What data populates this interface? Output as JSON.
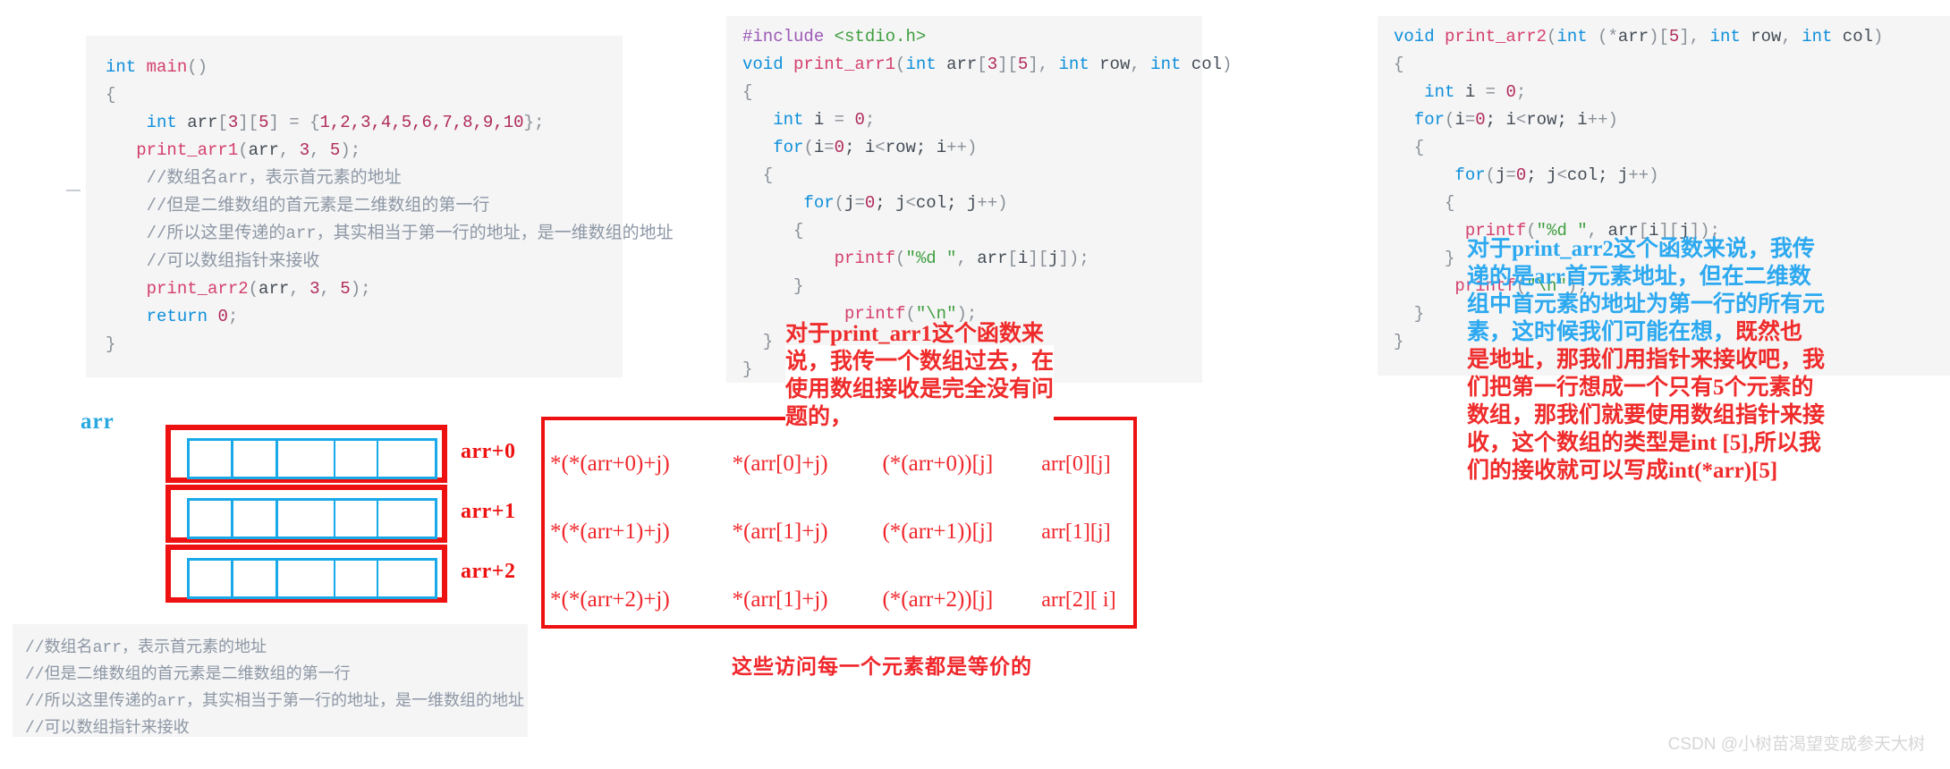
{
  "code_main": {
    "lines": [
      [
        {
          "t": "int",
          "c": "kw"
        },
        {
          "t": " ",
          "c": "ident"
        },
        {
          "t": "main",
          "c": "fn"
        },
        {
          "t": "()",
          "c": "punct"
        }
      ],
      [
        {
          "t": "{",
          "c": "punct"
        }
      ],
      [
        {
          "t": "    ",
          "c": "ident"
        },
        {
          "t": "int",
          "c": "kw"
        },
        {
          "t": " arr",
          "c": "ident"
        },
        {
          "t": "[",
          "c": "punct"
        },
        {
          "t": "3",
          "c": "num"
        },
        {
          "t": "][",
          "c": "punct"
        },
        {
          "t": "5",
          "c": "num"
        },
        {
          "t": "] ",
          "c": "punct"
        },
        {
          "t": "= ",
          "c": "punct"
        },
        {
          "t": "{",
          "c": "punct"
        },
        {
          "t": "1,2,3,4,5,6,7,8,9,10",
          "c": "num"
        },
        {
          "t": "};",
          "c": "punct"
        }
      ],
      [
        {
          "t": "   ",
          "c": "ident"
        },
        {
          "t": "print_arr1",
          "c": "fn"
        },
        {
          "t": "(",
          "c": "punct"
        },
        {
          "t": "arr",
          "c": "ident"
        },
        {
          "t": ", ",
          "c": "punct"
        },
        {
          "t": "3",
          "c": "num"
        },
        {
          "t": ", ",
          "c": "punct"
        },
        {
          "t": "5",
          "c": "num"
        },
        {
          "t": ");",
          "c": "punct"
        }
      ],
      [
        {
          "t": "    //数组名arr，表示首元素的地址",
          "c": "cmt"
        }
      ],
      [
        {
          "t": "    //但是二维数组的首元素是二维数组的第一行",
          "c": "cmt"
        }
      ],
      [
        {
          "t": "    //所以这里传递的arr，其实相当于第一行的地址，是一维数组的地址",
          "c": "cmt"
        }
      ],
      [
        {
          "t": "    //可以数组指针来接收",
          "c": "cmt"
        }
      ],
      [
        {
          "t": "    ",
          "c": "ident"
        },
        {
          "t": "print_arr2",
          "c": "fn"
        },
        {
          "t": "(",
          "c": "punct"
        },
        {
          "t": "arr",
          "c": "ident"
        },
        {
          "t": ", ",
          "c": "punct"
        },
        {
          "t": "3",
          "c": "num"
        },
        {
          "t": ", ",
          "c": "punct"
        },
        {
          "t": "5",
          "c": "num"
        },
        {
          "t": ");",
          "c": "punct"
        }
      ],
      [
        {
          "t": "    ",
          "c": "ident"
        },
        {
          "t": "return",
          "c": "kw"
        },
        {
          "t": " ",
          "c": "ident"
        },
        {
          "t": "0",
          "c": "num"
        },
        {
          "t": ";",
          "c": "punct"
        }
      ],
      [
        {
          "t": "}",
          "c": "punct"
        }
      ],
      [
        {
          "t": "",
          "c": "punct"
        }
      ]
    ]
  },
  "code_arr1": {
    "lines": [
      [
        {
          "t": "#include",
          "c": "pre"
        },
        {
          "t": " ",
          "c": "ident"
        },
        {
          "t": "<stdio.h>",
          "c": "str"
        }
      ],
      [
        {
          "t": "void",
          "c": "kw"
        },
        {
          "t": " ",
          "c": "ident"
        },
        {
          "t": "print_arr1",
          "c": "fn"
        },
        {
          "t": "(",
          "c": "punct"
        },
        {
          "t": "int",
          "c": "kw"
        },
        {
          "t": " arr",
          "c": "ident"
        },
        {
          "t": "[",
          "c": "punct"
        },
        {
          "t": "3",
          "c": "num"
        },
        {
          "t": "][",
          "c": "punct"
        },
        {
          "t": "5",
          "c": "num"
        },
        {
          "t": "], ",
          "c": "punct"
        },
        {
          "t": "int",
          "c": "kw"
        },
        {
          "t": " row",
          "c": "ident"
        },
        {
          "t": ", ",
          "c": "punct"
        },
        {
          "t": "int",
          "c": "kw"
        },
        {
          "t": " col",
          "c": "ident"
        },
        {
          "t": ")",
          "c": "punct"
        }
      ],
      [
        {
          "t": "{",
          "c": "punct"
        }
      ],
      [
        {
          "t": "   ",
          "c": "ident"
        },
        {
          "t": "int",
          "c": "kw"
        },
        {
          "t": " i ",
          "c": "ident"
        },
        {
          "t": "= ",
          "c": "punct"
        },
        {
          "t": "0",
          "c": "num"
        },
        {
          "t": ";",
          "c": "punct"
        }
      ],
      [
        {
          "t": "   ",
          "c": "ident"
        },
        {
          "t": "for",
          "c": "kw"
        },
        {
          "t": "(",
          "c": "punct"
        },
        {
          "t": "i",
          "c": "ident"
        },
        {
          "t": "=",
          "c": "punct"
        },
        {
          "t": "0",
          "c": "num"
        },
        {
          "t": "; i",
          "c": "ident"
        },
        {
          "t": "<",
          "c": "punct"
        },
        {
          "t": "row",
          "c": "ident"
        },
        {
          "t": "; i",
          "c": "ident"
        },
        {
          "t": "++",
          "c": "punct"
        },
        {
          "t": ")",
          "c": "punct"
        }
      ],
      [
        {
          "t": "  {",
          "c": "punct"
        }
      ],
      [
        {
          "t": "      ",
          "c": "ident"
        },
        {
          "t": "for",
          "c": "kw"
        },
        {
          "t": "(",
          "c": "punct"
        },
        {
          "t": "j",
          "c": "ident"
        },
        {
          "t": "=",
          "c": "punct"
        },
        {
          "t": "0",
          "c": "num"
        },
        {
          "t": "; j",
          "c": "ident"
        },
        {
          "t": "<",
          "c": "punct"
        },
        {
          "t": "col",
          "c": "ident"
        },
        {
          "t": "; j",
          "c": "ident"
        },
        {
          "t": "++",
          "c": "punct"
        },
        {
          "t": ")",
          "c": "punct"
        }
      ],
      [
        {
          "t": "     {",
          "c": "punct"
        }
      ],
      [
        {
          "t": "         ",
          "c": "ident"
        },
        {
          "t": "printf",
          "c": "fn"
        },
        {
          "t": "(",
          "c": "punct"
        },
        {
          "t": "\"%d \"",
          "c": "str"
        },
        {
          "t": ", ",
          "c": "punct"
        },
        {
          "t": "arr",
          "c": "ident"
        },
        {
          "t": "[",
          "c": "punct"
        },
        {
          "t": "i",
          "c": "ident"
        },
        {
          "t": "][",
          "c": "punct"
        },
        {
          "t": "j",
          "c": "ident"
        },
        {
          "t": "]);",
          "c": "punct"
        }
      ],
      [
        {
          "t": "     }",
          "c": "punct"
        }
      ],
      [
        {
          "t": "          ",
          "c": "ident"
        },
        {
          "t": "printf",
          "c": "fn"
        },
        {
          "t": "(",
          "c": "punct"
        },
        {
          "t": "\"\\n\"",
          "c": "str"
        },
        {
          "t": ");",
          "c": "punct"
        }
      ],
      [
        {
          "t": "  }",
          "c": "punct"
        }
      ],
      [
        {
          "t": "}",
          "c": "punct"
        }
      ]
    ]
  },
  "code_arr2": {
    "lines": [
      [
        {
          "t": "void",
          "c": "kw"
        },
        {
          "t": " ",
          "c": "ident"
        },
        {
          "t": "print_arr2",
          "c": "fn"
        },
        {
          "t": "(",
          "c": "punct"
        },
        {
          "t": "int",
          "c": "kw"
        },
        {
          "t": " ",
          "c": "ident"
        },
        {
          "t": "(*",
          "c": "punct"
        },
        {
          "t": "arr",
          "c": "ident"
        },
        {
          "t": ")[",
          "c": "punct"
        },
        {
          "t": "5",
          "c": "num"
        },
        {
          "t": "], ",
          "c": "punct"
        },
        {
          "t": "int",
          "c": "kw"
        },
        {
          "t": " row",
          "c": "ident"
        },
        {
          "t": ", ",
          "c": "punct"
        },
        {
          "t": "int",
          "c": "kw"
        },
        {
          "t": " col",
          "c": "ident"
        },
        {
          "t": ")",
          "c": "punct"
        }
      ],
      [
        {
          "t": "{",
          "c": "punct"
        }
      ],
      [
        {
          "t": "   ",
          "c": "ident"
        },
        {
          "t": "int",
          "c": "kw"
        },
        {
          "t": " i ",
          "c": "ident"
        },
        {
          "t": "= ",
          "c": "punct"
        },
        {
          "t": "0",
          "c": "num"
        },
        {
          "t": ";",
          "c": "punct"
        }
      ],
      [
        {
          "t": "  ",
          "c": "ident"
        },
        {
          "t": "for",
          "c": "kw"
        },
        {
          "t": "(",
          "c": "punct"
        },
        {
          "t": "i",
          "c": "ident"
        },
        {
          "t": "=",
          "c": "punct"
        },
        {
          "t": "0",
          "c": "num"
        },
        {
          "t": "; i",
          "c": "ident"
        },
        {
          "t": "<",
          "c": "punct"
        },
        {
          "t": "row",
          "c": "ident"
        },
        {
          "t": "; i",
          "c": "ident"
        },
        {
          "t": "++",
          "c": "punct"
        },
        {
          "t": ")",
          "c": "punct"
        }
      ],
      [
        {
          "t": "  {",
          "c": "punct"
        }
      ],
      [
        {
          "t": "      ",
          "c": "ident"
        },
        {
          "t": "for",
          "c": "kw"
        },
        {
          "t": "(",
          "c": "punct"
        },
        {
          "t": "j",
          "c": "ident"
        },
        {
          "t": "=",
          "c": "punct"
        },
        {
          "t": "0",
          "c": "num"
        },
        {
          "t": "; j",
          "c": "ident"
        },
        {
          "t": "<",
          "c": "punct"
        },
        {
          "t": "col",
          "c": "ident"
        },
        {
          "t": "; j",
          "c": "ident"
        },
        {
          "t": "++",
          "c": "punct"
        },
        {
          "t": ")",
          "c": "punct"
        }
      ],
      [
        {
          "t": "     {",
          "c": "punct"
        }
      ],
      [
        {
          "t": "       ",
          "c": "ident"
        },
        {
          "t": "printf",
          "c": "fn"
        },
        {
          "t": "(",
          "c": "punct"
        },
        {
          "t": "\"%d \"",
          "c": "str"
        },
        {
          "t": ", ",
          "c": "punct"
        },
        {
          "t": "arr",
          "c": "ident"
        },
        {
          "t": "[",
          "c": "punct"
        },
        {
          "t": "i",
          "c": "ident"
        },
        {
          "t": "][",
          "c": "punct"
        },
        {
          "t": "j",
          "c": "ident"
        },
        {
          "t": "]);",
          "c": "punct"
        }
      ],
      [
        {
          "t": "     }",
          "c": "punct"
        }
      ],
      [
        {
          "t": "      ",
          "c": "ident"
        },
        {
          "t": "printf",
          "c": "fn"
        },
        {
          "t": "(",
          "c": "punct"
        },
        {
          "t": "\"\\n\"",
          "c": "str"
        },
        {
          "t": ");",
          "c": "punct"
        }
      ],
      [
        {
          "t": "  }",
          "c": "punct"
        }
      ],
      [
        {
          "t": "}",
          "c": "punct"
        }
      ]
    ]
  },
  "code_bottom": {
    "lines": [
      [
        {
          "t": "//数组名arr，表示首元素的地址",
          "c": "cmt"
        }
      ],
      [
        {
          "t": "//但是二维数组的首元素是二维数组的第一行",
          "c": "cmt"
        }
      ],
      [
        {
          "t": "//所以这里传递的arr，其实相当于第一行的地址，是一维数组的地址",
          "c": "cmt"
        }
      ],
      [
        {
          "t": "//可以数组指针来接收",
          "c": "cmt"
        }
      ]
    ]
  },
  "diagram": {
    "array_label": "arr",
    "rows": [
      {
        "tag": "arr+0",
        "cells": 5
      },
      {
        "tag": "arr+1",
        "cells": 5
      },
      {
        "tag": "arr+2",
        "cells": 5
      }
    ]
  },
  "expr_table": {
    "rows": [
      [
        "*(*(arr+0)+j)",
        "*(arr[0]+j)",
        "(*(arr+0))[j]",
        "arr[0][j]"
      ],
      [
        "*(*(arr+1)+j)",
        "*(arr[1]+j)",
        "(*(arr+1))[j]",
        "arr[1][j]"
      ],
      [
        "*(*(arr+2)+j)",
        "*(arr[1]+j)",
        "(*(arr+2))[j]",
        "arr[2][ i]"
      ]
    ]
  },
  "annotations": {
    "arr1_note": "对于print_arr1这个函数来说，我传一个数组过去，在使用数组接收是完全没有问题的，",
    "arr2_note_blue": "对于print_arr2这个函数来说，我传递的是arr首元素地址，但在二维数组中首元素的地址为第一行的所有元素，这时候我们可能在想，",
    "arr2_note_red": "既然也是地址，那我们用指针来接收吧，我们把第一行想成一个只有5个元素的数组，那我们就要使用数组指针来接收，这个数组的类型是int [5],所以我们的接收就可以写成int(*arr)[5]",
    "caption": "这些访问每一个元素都是等价的"
  },
  "watermark": "CSDN @小树苗渴望变成参天大树",
  "colors": {
    "red": "#ee1111",
    "blue": "#17a9e8",
    "annot_red": "#ef2b2b",
    "annot_blue": "#2da9f0",
    "code_bg": "#f5f5f5"
  }
}
